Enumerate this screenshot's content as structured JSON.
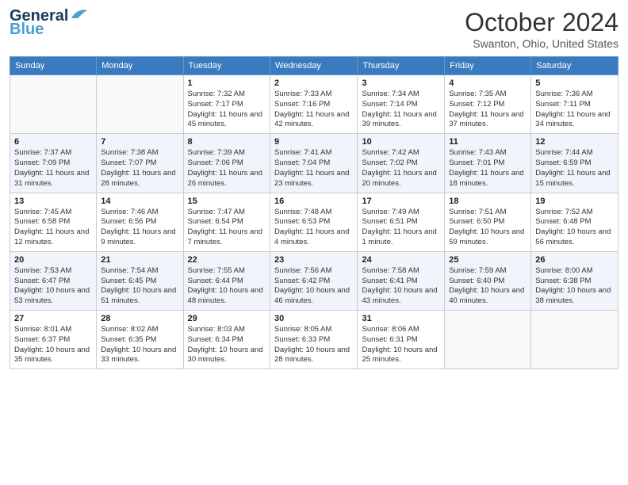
{
  "header": {
    "logo_line1": "General",
    "logo_line2": "Blue",
    "month": "October 2024",
    "location": "Swanton, Ohio, United States"
  },
  "days_of_week": [
    "Sunday",
    "Monday",
    "Tuesday",
    "Wednesday",
    "Thursday",
    "Friday",
    "Saturday"
  ],
  "weeks": [
    {
      "days": [
        {
          "num": "",
          "info": ""
        },
        {
          "num": "",
          "info": ""
        },
        {
          "num": "1",
          "info": "Sunrise: 7:32 AM\nSunset: 7:17 PM\nDaylight: 11 hours and 45 minutes."
        },
        {
          "num": "2",
          "info": "Sunrise: 7:33 AM\nSunset: 7:16 PM\nDaylight: 11 hours and 42 minutes."
        },
        {
          "num": "3",
          "info": "Sunrise: 7:34 AM\nSunset: 7:14 PM\nDaylight: 11 hours and 39 minutes."
        },
        {
          "num": "4",
          "info": "Sunrise: 7:35 AM\nSunset: 7:12 PM\nDaylight: 11 hours and 37 minutes."
        },
        {
          "num": "5",
          "info": "Sunrise: 7:36 AM\nSunset: 7:11 PM\nDaylight: 11 hours and 34 minutes."
        }
      ]
    },
    {
      "days": [
        {
          "num": "6",
          "info": "Sunrise: 7:37 AM\nSunset: 7:09 PM\nDaylight: 11 hours and 31 minutes."
        },
        {
          "num": "7",
          "info": "Sunrise: 7:38 AM\nSunset: 7:07 PM\nDaylight: 11 hours and 28 minutes."
        },
        {
          "num": "8",
          "info": "Sunrise: 7:39 AM\nSunset: 7:06 PM\nDaylight: 11 hours and 26 minutes."
        },
        {
          "num": "9",
          "info": "Sunrise: 7:41 AM\nSunset: 7:04 PM\nDaylight: 11 hours and 23 minutes."
        },
        {
          "num": "10",
          "info": "Sunrise: 7:42 AM\nSunset: 7:02 PM\nDaylight: 11 hours and 20 minutes."
        },
        {
          "num": "11",
          "info": "Sunrise: 7:43 AM\nSunset: 7:01 PM\nDaylight: 11 hours and 18 minutes."
        },
        {
          "num": "12",
          "info": "Sunrise: 7:44 AM\nSunset: 6:59 PM\nDaylight: 11 hours and 15 minutes."
        }
      ]
    },
    {
      "days": [
        {
          "num": "13",
          "info": "Sunrise: 7:45 AM\nSunset: 6:58 PM\nDaylight: 11 hours and 12 minutes."
        },
        {
          "num": "14",
          "info": "Sunrise: 7:46 AM\nSunset: 6:56 PM\nDaylight: 11 hours and 9 minutes."
        },
        {
          "num": "15",
          "info": "Sunrise: 7:47 AM\nSunset: 6:54 PM\nDaylight: 11 hours and 7 minutes."
        },
        {
          "num": "16",
          "info": "Sunrise: 7:48 AM\nSunset: 6:53 PM\nDaylight: 11 hours and 4 minutes."
        },
        {
          "num": "17",
          "info": "Sunrise: 7:49 AM\nSunset: 6:51 PM\nDaylight: 11 hours and 1 minute."
        },
        {
          "num": "18",
          "info": "Sunrise: 7:51 AM\nSunset: 6:50 PM\nDaylight: 10 hours and 59 minutes."
        },
        {
          "num": "19",
          "info": "Sunrise: 7:52 AM\nSunset: 6:48 PM\nDaylight: 10 hours and 56 minutes."
        }
      ]
    },
    {
      "days": [
        {
          "num": "20",
          "info": "Sunrise: 7:53 AM\nSunset: 6:47 PM\nDaylight: 10 hours and 53 minutes."
        },
        {
          "num": "21",
          "info": "Sunrise: 7:54 AM\nSunset: 6:45 PM\nDaylight: 10 hours and 51 minutes."
        },
        {
          "num": "22",
          "info": "Sunrise: 7:55 AM\nSunset: 6:44 PM\nDaylight: 10 hours and 48 minutes."
        },
        {
          "num": "23",
          "info": "Sunrise: 7:56 AM\nSunset: 6:42 PM\nDaylight: 10 hours and 46 minutes."
        },
        {
          "num": "24",
          "info": "Sunrise: 7:58 AM\nSunset: 6:41 PM\nDaylight: 10 hours and 43 minutes."
        },
        {
          "num": "25",
          "info": "Sunrise: 7:59 AM\nSunset: 6:40 PM\nDaylight: 10 hours and 40 minutes."
        },
        {
          "num": "26",
          "info": "Sunrise: 8:00 AM\nSunset: 6:38 PM\nDaylight: 10 hours and 38 minutes."
        }
      ]
    },
    {
      "days": [
        {
          "num": "27",
          "info": "Sunrise: 8:01 AM\nSunset: 6:37 PM\nDaylight: 10 hours and 35 minutes."
        },
        {
          "num": "28",
          "info": "Sunrise: 8:02 AM\nSunset: 6:35 PM\nDaylight: 10 hours and 33 minutes."
        },
        {
          "num": "29",
          "info": "Sunrise: 8:03 AM\nSunset: 6:34 PM\nDaylight: 10 hours and 30 minutes."
        },
        {
          "num": "30",
          "info": "Sunrise: 8:05 AM\nSunset: 6:33 PM\nDaylight: 10 hours and 28 minutes."
        },
        {
          "num": "31",
          "info": "Sunrise: 8:06 AM\nSunset: 6:31 PM\nDaylight: 10 hours and 25 minutes."
        },
        {
          "num": "",
          "info": ""
        },
        {
          "num": "",
          "info": ""
        }
      ]
    }
  ]
}
